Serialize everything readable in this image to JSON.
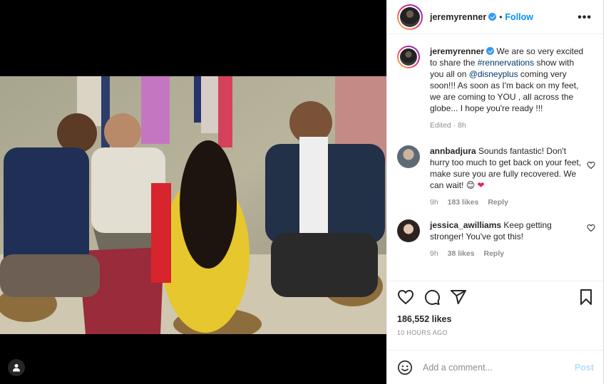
{
  "post": {
    "username": "jeremyrenner",
    "follow_label": "Follow",
    "dot": "•",
    "more_label": "•••",
    "caption_pre": "We are so very excited to share the ",
    "caption_hashtag": "#rennervations",
    "caption_mid": " show with you all on ",
    "caption_mention": "@disneyplus",
    "caption_post": " coming very soon!!! As soon as I'm back on my feet, we are coming to YOU , all across the globe... I hope you're ready !!!",
    "caption_meta": "Edited · 8h"
  },
  "comments": [
    {
      "username": "annbadjura",
      "text": "Sounds fantastic! Don't hurry too much to get back on your feet, make sure you are fully recovered. We can wait! 😊",
      "time": "9h",
      "likes": "183 likes",
      "reply": "Reply"
    },
    {
      "username": "jessica_awilliams",
      "text": "Keep getting stronger! You've got this!",
      "time": "9h",
      "likes": "38 likes",
      "reply": "Reply"
    }
  ],
  "engagement": {
    "likes": "186,552 likes",
    "timestamp": "10 HOURS AGO"
  },
  "add_comment": {
    "placeholder": "Add a comment...",
    "post_label": "Post"
  },
  "icons": {
    "verified": "verified-badge-icon",
    "like": "heart-icon",
    "comment": "comment-icon",
    "share": "share-icon",
    "save": "bookmark-icon",
    "emoji": "emoji-icon",
    "user_tag": "user-tag-icon"
  },
  "colors": {
    "accent": "#0095f6",
    "post_disabled": "#b2dffc",
    "muted": "#8e8e8e"
  }
}
